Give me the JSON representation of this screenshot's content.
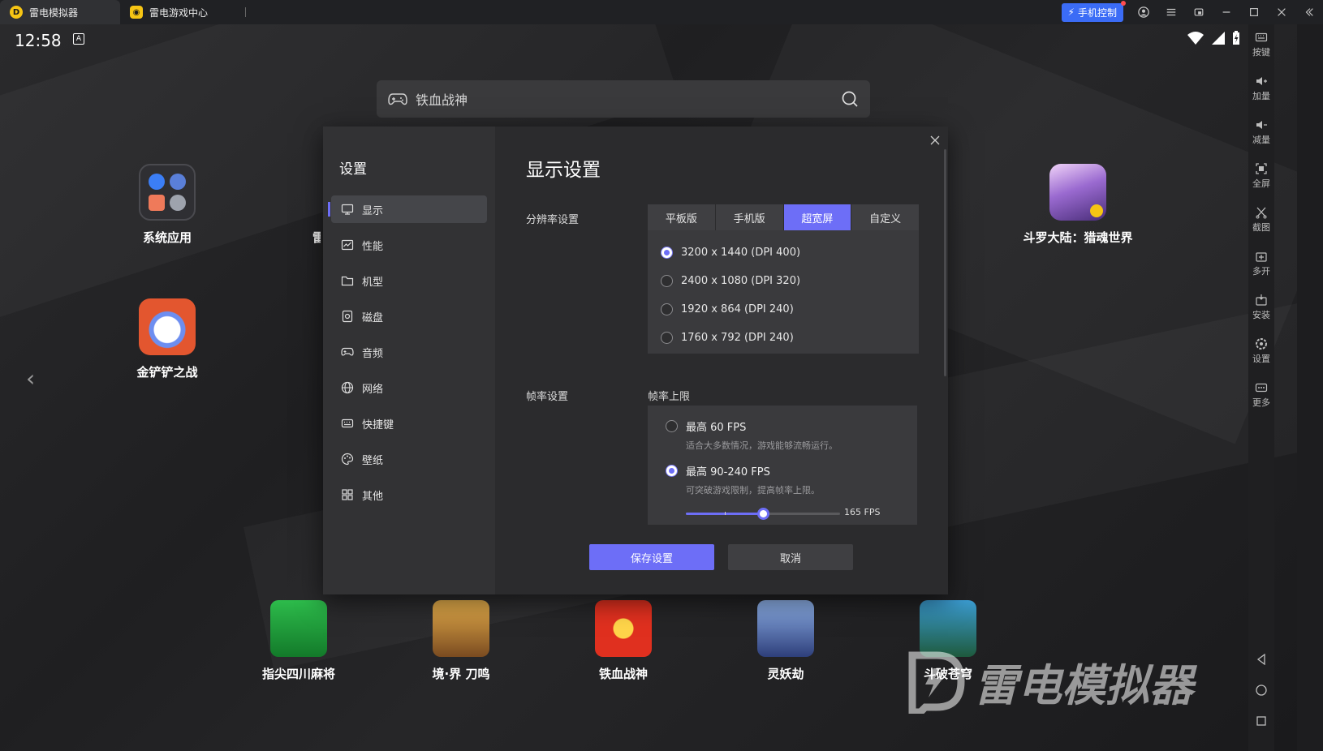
{
  "tabs": [
    {
      "label": "雷电模拟器",
      "active": true
    },
    {
      "label": "雷电游戏中心",
      "active": false
    }
  ],
  "titlebar": {
    "phone_control": "手机控制"
  },
  "status": {
    "time": "12:58",
    "badge": "A"
  },
  "search": {
    "text": "铁血战神"
  },
  "apps": [
    {
      "label": "系统应用",
      "icon": "system-apps-icon",
      "color": "#2f2f33"
    },
    {
      "label": "金铲铲之战",
      "icon": "golden-spatula-icon",
      "color": "#e3562f"
    },
    {
      "label": "雷",
      "icon": "ldplayer-app-icon",
      "color": "#d8a21c"
    },
    {
      "label": "斗罗大陆：猎魂世界",
      "icon": "douluo-icon",
      "color": "#8a5bc4"
    },
    {
      "label": "指尖四川麻将",
      "icon": "mahjong-icon",
      "color": "#1d9b3a"
    },
    {
      "label": "境·界 刀鸣",
      "icon": "bleach-icon",
      "color": "#c98a3c"
    },
    {
      "label": "铁血战神",
      "icon": "tiexue-icon",
      "color": "#c42a1f"
    },
    {
      "label": "灵妖劫",
      "icon": "lingyao-icon",
      "color": "#3f5fa8"
    },
    {
      "label": "斗破苍穹",
      "icon": "doupo-icon",
      "color": "#2c7a5d"
    }
  ],
  "watermark": "雷电模拟器",
  "right_toolbar": [
    {
      "label": "按键",
      "icon": "keyboard-icon"
    },
    {
      "label": "加量",
      "icon": "volume-up-icon"
    },
    {
      "label": "减量",
      "icon": "volume-down-icon"
    },
    {
      "label": "全屏",
      "icon": "fullscreen-icon"
    },
    {
      "label": "截图",
      "icon": "screenshot-icon"
    },
    {
      "label": "多开",
      "icon": "multi-instance-icon"
    },
    {
      "label": "安装",
      "icon": "install-icon"
    },
    {
      "label": "设置",
      "icon": "settings-icon"
    },
    {
      "label": "更多",
      "icon": "more-icon"
    }
  ],
  "settings": {
    "title": "设置",
    "menu": [
      {
        "label": "显示",
        "icon": "monitor-icon",
        "active": true
      },
      {
        "label": "性能",
        "icon": "performance-icon"
      },
      {
        "label": "机型",
        "icon": "folder-icon"
      },
      {
        "label": "磁盘",
        "icon": "disk-icon"
      },
      {
        "label": "音频",
        "icon": "gamepad-icon"
      },
      {
        "label": "网络",
        "icon": "globe-icon"
      },
      {
        "label": "快捷键",
        "icon": "keyboard-icon"
      },
      {
        "label": "壁纸",
        "icon": "palette-icon"
      },
      {
        "label": "其他",
        "icon": "grid-icon"
      }
    ],
    "heading": "显示设置",
    "resolution": {
      "label": "分辨率设置",
      "modes": [
        "平板版",
        "手机版",
        "超宽屏",
        "自定义"
      ],
      "active_mode": 2,
      "options": [
        {
          "text": "3200 x 1440  (DPI 400)",
          "selected": true
        },
        {
          "text": "2400 x 1080  (DPI 320)",
          "selected": false
        },
        {
          "text": "1920 x 864  (DPI 240)",
          "selected": false
        },
        {
          "text": "1760 x 792  (DPI 240)",
          "selected": false
        }
      ]
    },
    "framerate": {
      "label": "帧率设置",
      "sublabel": "帧率上限",
      "options": [
        {
          "title": "最高 60 FPS",
          "hint": "适合大多数情况，游戏能够流畅运行。",
          "selected": false
        },
        {
          "title": "最高 90-240 FPS",
          "hint": "可突破游戏限制，提高帧率上限。",
          "selected": true
        }
      ],
      "slider_min": 90,
      "slider_max": 240,
      "slider_value": 165,
      "value_text": "165 FPS"
    },
    "buttons": {
      "save": "保存设置",
      "cancel": "取消"
    }
  }
}
